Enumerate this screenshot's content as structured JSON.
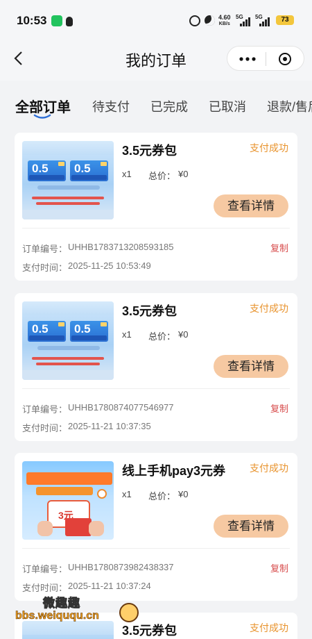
{
  "status_bar": {
    "time": "10:53",
    "net_speed": "4.60",
    "net_unit": "KB/s",
    "sig1": "5G",
    "sig2": "5G",
    "battery": "73"
  },
  "nav": {
    "title": "我的订单"
  },
  "tabs": [
    {
      "label": "全部订单",
      "active": true
    },
    {
      "label": "待支付"
    },
    {
      "label": "已完成"
    },
    {
      "label": "已取消"
    },
    {
      "label": "退款/售后"
    }
  ],
  "labels": {
    "total": "总价：",
    "order_no": "订单编号：",
    "pay_time": "支付时间：",
    "detail_button": "查看详情",
    "copy": "复制"
  },
  "orders": [
    {
      "name": "3.5元券包",
      "status": "支付成功",
      "qty": "x1",
      "price": "¥0",
      "order_no": "UHHB1783713208593185",
      "pay_time": "2025-11-25 10:53:49",
      "thumb": {
        "coupon_left": "0.5",
        "coupon_right": "0.5"
      }
    },
    {
      "name": "3.5元券包",
      "status": "支付成功",
      "qty": "x1",
      "price": "¥0",
      "order_no": "UHHB1780874077546977",
      "pay_time": "2025-11-21 10:37:35",
      "thumb": {
        "coupon_left": "0.5",
        "coupon_right": "0.5"
      }
    },
    {
      "name": "线上手机pay3元券",
      "status": "支付成功",
      "qty": "x1",
      "price": "¥0",
      "order_no": "UHHB1780873982438337",
      "pay_time": "2025-11-21 10:37:24",
      "thumb": {
        "amount": "3元"
      }
    },
    {
      "name": "3.5元券包",
      "status": "支付成功"
    }
  ],
  "watermark": {
    "line1": "微趣趣",
    "line2": "bbs.weiququ.cn"
  },
  "colors": {
    "accent_orange": "#e8932d",
    "button_bg": "#f6c9a2",
    "copy_red": "#d74b4b"
  }
}
